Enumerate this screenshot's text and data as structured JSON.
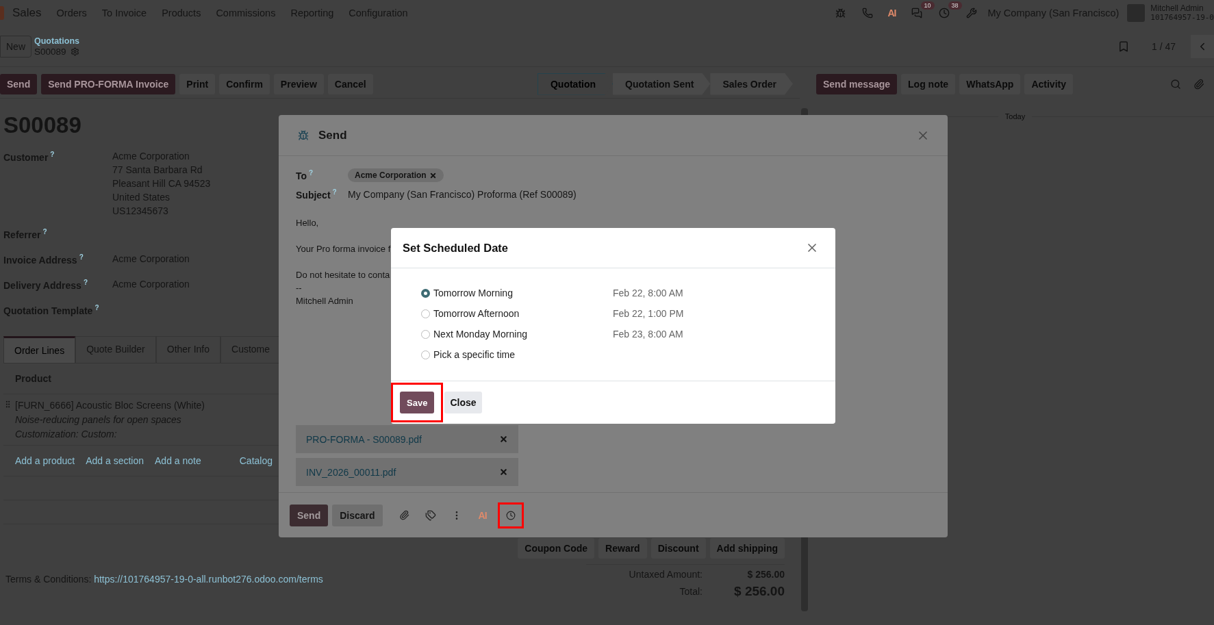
{
  "navbar": {
    "app": "Sales",
    "menu": [
      "Orders",
      "To Invoice",
      "Products",
      "Commissions",
      "Reporting",
      "Configuration"
    ],
    "ai_label": "AI",
    "chat_count": "10",
    "activity_count": "38",
    "company": "My Company (San Francisco)",
    "user": {
      "name": "Mitchell Admin",
      "database": "101764957-19-0"
    }
  },
  "control_panel": {
    "new_button": "New",
    "breadcrumb": "Quotations",
    "record": "S00089",
    "pager": "1 / 47"
  },
  "actions": [
    {
      "label": "Send",
      "primary": true
    },
    {
      "label": "Send PRO-FORMA Invoice",
      "primary": true
    },
    {
      "label": "Print",
      "primary": false
    },
    {
      "label": "Confirm",
      "primary": false
    },
    {
      "label": "Preview",
      "primary": false
    },
    {
      "label": "Cancel",
      "primary": false
    }
  ],
  "status_steps": [
    {
      "label": "Quotation",
      "selected": true
    },
    {
      "label": "Quotation Sent",
      "selected": false
    },
    {
      "label": "Sales Order",
      "selected": false
    }
  ],
  "chatter": {
    "buttons": [
      {
        "label": "Send message",
        "primary": true
      },
      {
        "label": "Log note",
        "primary": false
      },
      {
        "label": "WhatsApp",
        "primary": false
      },
      {
        "label": "Activity",
        "primary": false
      }
    ],
    "day": "Today"
  },
  "form": {
    "title": "S00089",
    "fields": [
      {
        "label": "Customer$^{?}$",
        "value": [
          "Acme Corporation",
          "77 Santa Barbara Rd",
          "Pleasant Hill CA 94523",
          "United States",
          "US12345673"
        ]
      },
      {
        "label": "Referrer$^{?}$"
      },
      {
        "label": "Invoice Address$^{?}$",
        "value": [
          "Acme Corporation"
        ]
      },
      {
        "label": "Delivery Address$^{?}$",
        "value": [
          "Acme Corporation"
        ]
      },
      {
        "label": "Quotation Template$^{?}$"
      }
    ],
    "tabs": [
      {
        "label": "Order Lines",
        "selected": true
      },
      {
        "label": "Quote Builder",
        "selected": false
      },
      {
        "label": "Other Info",
        "selected": false
      },
      {
        "label": "Custome",
        "selected": false
      }
    ],
    "table": {
      "columns": [
        "Product"
      ],
      "rows": [
        {
          "name": "[FURN_6666] Acoustic Bloc Screens (White)",
          "description": "Noise-reducing panels for open spaces",
          "customization": "Customization: Custom:"
        }
      ]
    },
    "add_links": [
      "Add a product",
      "Add a section",
      "Add a note",
      "Catalog"
    ],
    "extra_buttons": [
      "Coupon Code",
      "Reward",
      "Discount",
      "Add shipping"
    ],
    "terms": {
      "label": "Terms & Conditions:",
      "link": "https://101764957-19-0-all.runbot276.odoo.com/terms"
    },
    "totals": [
      {
        "label": "Untaxed Amount:",
        "value": "$ 256.00",
        "grand": false
      },
      {
        "label": "Total:",
        "value": "$ 256.00",
        "grand": true
      }
    ]
  },
  "send_dialog": {
    "title": "Send",
    "to_label": "To$^{?}$",
    "recipients": [
      "Acme Corporation"
    ],
    "subject_label": "Subject$^{?}$",
    "subject": "My Company (San Francisco) Proforma (Ref S00089)",
    "body": [
      "Hello,",
      "Your Pro forma invoice f",
      "Do not hesitate to conta",
      "--",
      "Mitchell Admin"
    ],
    "attachments": [
      "PRO-FORMA - S00089.pdf",
      "INV_2026_00011.pdf"
    ],
    "send_button": "Send",
    "discard_button": "Discard",
    "ai_label": "AI",
    "schedule_highlighted": true
  },
  "schedule_dialog": {
    "title": "Set Scheduled Date",
    "options": [
      {
        "label": "Tomorrow Morning",
        "date": "Feb 22, 8:00 AM",
        "selected": true
      },
      {
        "label": "Tomorrow Afternoon",
        "date": "Feb 22, 1:00 PM",
        "selected": false
      },
      {
        "label": "Next Monday Morning",
        "date": "Feb 23, 8:00 AM",
        "selected": false
      },
      {
        "label": "Pick a specific time",
        "selected": false
      }
    ],
    "save_button": "Save",
    "save_highlighted": true,
    "close_button": "Close"
  }
}
